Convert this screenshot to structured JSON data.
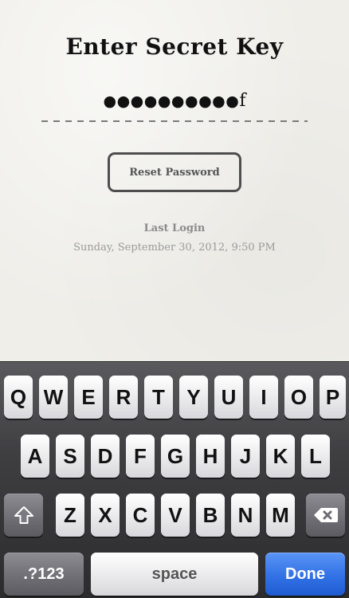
{
  "screen": {
    "title": "Enter Secret Key",
    "secret_masked": "●●●●●●●●●●",
    "secret_last_char": "f",
    "reset_button_label": "Reset Password",
    "last_login_label": "Last Login",
    "last_login_value": "Sunday, September 30, 2012, 9:50 PM"
  },
  "keyboard": {
    "row1": [
      "Q",
      "W",
      "E",
      "R",
      "T",
      "Y",
      "U",
      "I",
      "O",
      "P"
    ],
    "row2": [
      "A",
      "S",
      "D",
      "F",
      "G",
      "H",
      "J",
      "K",
      "L"
    ],
    "row3": [
      "Z",
      "X",
      "C",
      "V",
      "B",
      "N",
      "M"
    ],
    "shift_icon": "shift-arrow-icon",
    "backspace_icon": "backspace-icon",
    "numbers_label": ".?123",
    "space_label": "space",
    "done_label": "Done"
  },
  "colors": {
    "done_key": "#2f6fe4",
    "paper": "#efeee9"
  }
}
